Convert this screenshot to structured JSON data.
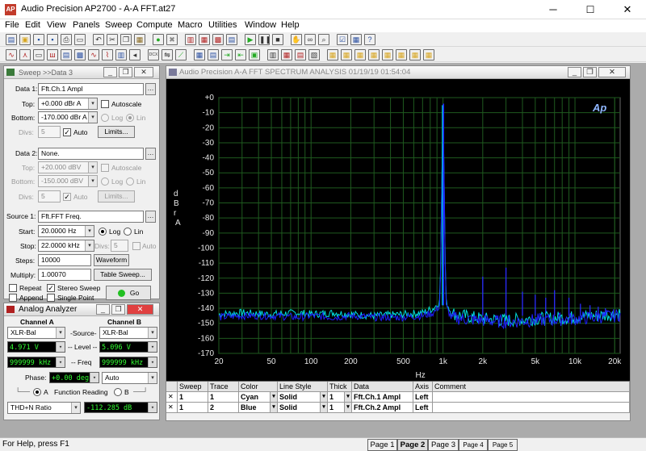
{
  "window": {
    "title": "Audio Precision AP2700 - A-A FFT.at27",
    "icon": "AP",
    "minimize": "─",
    "maximize": "☐",
    "close": "✕"
  },
  "menu": [
    "File",
    "Edit",
    "View",
    "Panels",
    "Sweep",
    "Compute",
    "Macro",
    "Utilities",
    "Window",
    "Help"
  ],
  "toolbar": {
    "row1": [
      {
        "icon": "new-doc-icon",
        "glyph": "▤",
        "color": "#2a4fa0"
      },
      {
        "icon": "open-folder-icon",
        "glyph": "▣",
        "color": "#d7a520"
      },
      {
        "icon": "save-icon",
        "glyph": "▪",
        "color": "#1f4f9f"
      },
      {
        "icon": "save-as-icon",
        "glyph": "▪",
        "color": "#1f4f9f"
      },
      {
        "icon": "print-icon",
        "glyph": "⎙",
        "color": "#333333"
      },
      {
        "icon": "preview-icon",
        "glyph": "▭",
        "color": "#333333"
      },
      {
        "icon": "undo-icon",
        "glyph": "↶",
        "color": "#333333"
      },
      {
        "icon": "cut-icon",
        "glyph": "✂",
        "color": "#333333"
      },
      {
        "icon": "copy-icon",
        "glyph": "❐",
        "color": "#333333"
      },
      {
        "icon": "paste-icon",
        "glyph": "▦",
        "color": "#8a6a20"
      },
      {
        "icon": "record-icon",
        "glyph": "●",
        "color": "#22aa22"
      },
      {
        "icon": "stop-record-icon",
        "glyph": "✖",
        "color": "#888888"
      },
      {
        "icon": "sweep-settings-icon",
        "glyph": "▥",
        "color": "#b02020"
      },
      {
        "icon": "analyzer-icon",
        "glyph": "▦",
        "color": "#b02020"
      },
      {
        "icon": "generator-icon",
        "glyph": "▩",
        "color": "#b02020"
      },
      {
        "icon": "graph-icon",
        "glyph": "▤",
        "color": "#2a4fa0"
      },
      {
        "icon": "play-icon",
        "glyph": "▶",
        "color": "#22aa22"
      },
      {
        "icon": "pause-icon",
        "glyph": "❚❚",
        "color": "#333333"
      },
      {
        "icon": "stop-icon",
        "glyph": "■",
        "color": "#333333"
      },
      {
        "icon": "hand-icon",
        "glyph": "✋",
        "color": "#333333"
      },
      {
        "icon": "binoculars-icon",
        "glyph": "∞",
        "color": "#333333"
      },
      {
        "icon": "zoom-icon",
        "glyph": "⌕",
        "color": "#333333"
      },
      {
        "icon": "check-list-icon",
        "glyph": "☑",
        "color": "#2a4fa0"
      },
      {
        "icon": "chart-check-icon",
        "glyph": "▦",
        "color": "#2a4fa0"
      },
      {
        "icon": "help-pointer-icon",
        "glyph": "?",
        "color": "#2a4fa0"
      }
    ],
    "row2": [
      {
        "icon": "sine-wave-icon",
        "glyph": "∿",
        "color": "#b02020"
      },
      {
        "icon": "filter-icon",
        "glyph": "⋏",
        "color": "#b02020"
      },
      {
        "icon": "channel-icon",
        "glyph": "▭",
        "color": "#333333"
      },
      {
        "icon": "multitone-icon",
        "glyph": "ш",
        "color": "#b02020"
      },
      {
        "icon": "meter-icon",
        "glyph": "▤",
        "color": "#2a4fa0"
      },
      {
        "icon": "dsp-icon",
        "glyph": "▩",
        "color": "#2a4fa0"
      },
      {
        "icon": "wave-chart-icon",
        "glyph": "∿",
        "color": "#b02020"
      },
      {
        "icon": "waveform-icon",
        "glyph": "⌇",
        "color": "#b02020"
      },
      {
        "icon": "spectrum-icon",
        "glyph": "▥",
        "color": "#2a4fa0"
      },
      {
        "icon": "speaker-icon",
        "glyph": "◂",
        "color": "#333333"
      },
      {
        "icon": "dcx-icon",
        "glyph": "DCX",
        "color": "#333333"
      },
      {
        "icon": "switcher-icon",
        "glyph": "⇋",
        "color": "#333333"
      },
      {
        "icon": "sweep-graph-icon",
        "glyph": "⟋",
        "color": "#22aa22"
      },
      {
        "icon": "table-icon",
        "glyph": "▦",
        "color": "#2a4fa0"
      },
      {
        "icon": "limits-icon",
        "glyph": "▤",
        "color": "#2a4fa0"
      },
      {
        "icon": "export-icon",
        "glyph": "⇥",
        "color": "#22aa22"
      },
      {
        "icon": "import-icon",
        "glyph": "⇤",
        "color": "#22aa22"
      },
      {
        "icon": "compute-icon",
        "glyph": "▣",
        "color": "#22aa22"
      },
      {
        "icon": "graph-options-icon",
        "glyph": "▥",
        "color": "#333333"
      },
      {
        "icon": "fft-icon",
        "glyph": "▦",
        "color": "#b02020"
      },
      {
        "icon": "plot-icon",
        "glyph": "▤",
        "color": "#b02020"
      },
      {
        "icon": "log-icon",
        "glyph": "▧",
        "color": "#333333"
      },
      {
        "icon": "chart-a-icon",
        "glyph": "▦",
        "color": "#d7a520"
      },
      {
        "icon": "chart-b-icon",
        "glyph": "▦",
        "color": "#d7a520"
      },
      {
        "icon": "chart-c-icon",
        "glyph": "▦",
        "color": "#d7a520"
      },
      {
        "icon": "chart-d-icon",
        "glyph": "▦",
        "color": "#d7a520"
      },
      {
        "icon": "chart-e-icon",
        "glyph": "▦",
        "color": "#d7a520"
      },
      {
        "icon": "chart-f-icon",
        "glyph": "▦",
        "color": "#d7a520"
      },
      {
        "icon": "chart-g-icon",
        "glyph": "▦",
        "color": "#d7a520"
      },
      {
        "icon": "chart-h-icon",
        "glyph": "▦",
        "color": "#d7a520"
      }
    ]
  },
  "sweep": {
    "title": "Sweep  >>Data 3",
    "data1_label": "Data 1:",
    "data1_value": "Fft.Ch.1 Ampl",
    "top_label": "Top:",
    "top_value": "+0.000  dBr A",
    "bottom_label": "Bottom:",
    "bottom_value": "-170.000 dBr A",
    "autoscale": "Autoscale",
    "log": "Log",
    "lin": "Lin",
    "divs_label": "Divs:",
    "divs_value": "5",
    "auto": "Auto",
    "limits": "Limits...",
    "data2_label": "Data 2:",
    "data2_value": "None.",
    "top2_value": "+20.000  dBV",
    "bottom2_value": "-150.000 dBV",
    "divs2_value": "5",
    "source_label": "Source 1:",
    "source_value": "Fft.FFT Freq.",
    "start_label": "Start:",
    "start_value": "20.0000  Hz",
    "stop_label": "Stop:",
    "stop_value": "22.0000 kHz",
    "divs3_value": "5",
    "steps_label": "Steps:",
    "steps_value": "10000",
    "waveform": "Waveform",
    "multiply_label": "Multiply:",
    "multiply_value": "1.00070",
    "table_sweep": "Table Sweep...",
    "repeat": "Repeat",
    "stereo_sweep": "Stereo Sweep",
    "append": "Append",
    "single_point": "Single Point",
    "go": "Go"
  },
  "analyzer": {
    "title": "Analog Analyzer",
    "channel_a": "Channel A",
    "channel_b": "Channel B",
    "source_label": "-Source-",
    "input_a": "XLR-Bal",
    "input_b": "XLR-Bal",
    "level_label": "-- Level --",
    "level_a": "4.971   V",
    "level_b": "5.096   V",
    "freq_label": "-- Freq",
    "freq_a": "999999 kHz",
    "freq_b": "999999 kHz",
    "phase_label": "Phase:",
    "phase_value": "+0.00   deg",
    "phase_mode": "Auto",
    "reading_a": "A",
    "function_reading": "Function Reading",
    "reading_b": "B",
    "function_mode": "THD+N Ratio",
    "function_value": "-112.285 dB"
  },
  "graph": {
    "titlebar": "Audio Precision     A-A FFT SPECTRUM ANALYSIS     01/19/19 01:54:04",
    "logo": "Ap",
    "grid_color": "#1f5a1f"
  },
  "chart_data": {
    "type": "line",
    "title": "A-A FFT SPECTRUM ANALYSIS",
    "ylabel": "d B r  A",
    "xlabel": "Hz",
    "x_scale": "log",
    "xlim": [
      20,
      22000
    ],
    "ylim": [
      -170,
      0
    ],
    "grid": true,
    "y_ticks": [
      "+0",
      "-10",
      "-20",
      "-30",
      "-40",
      "-50",
      "-60",
      "-70",
      "-80",
      "-90",
      "-100",
      "-110",
      "-120",
      "-130",
      "-140",
      "-150",
      "-160",
      "-170"
    ],
    "x_ticks": [
      "20",
      "50",
      "100",
      "200",
      "500",
      "1k",
      "2k",
      "5k",
      "10k",
      "20k"
    ],
    "series": [
      {
        "name": "Fft.Ch.1 Ampl",
        "color": "#00e0e0",
        "x": [
          20,
          30,
          50,
          80,
          100,
          150,
          200,
          300,
          500,
          700,
          850,
          950,
          1000,
          1050,
          1150,
          1400,
          2000,
          3000,
          5000,
          10000,
          20000,
          22000
        ],
        "y": [
          -144,
          -143,
          -144,
          -143,
          -144,
          -143,
          -144,
          -145,
          -144,
          -143,
          -140,
          -135,
          -5,
          -135,
          -143,
          -145,
          -147,
          -148,
          -147,
          -146,
          -144,
          -143
        ]
      },
      {
        "name": "Fft.Ch.2 Ampl",
        "color": "#2020ff",
        "x": [
          20,
          30,
          50,
          80,
          100,
          150,
          200,
          300,
          500,
          700,
          850,
          950,
          1000,
          1050,
          1150,
          1400,
          2000,
          3000,
          5000,
          10000,
          20000,
          22000
        ],
        "y": [
          -146,
          -145,
          -145,
          -146,
          -145,
          -146,
          -145,
          -146,
          -146,
          -145,
          -143,
          -138,
          -4,
          -138,
          -146,
          -147,
          -148,
          -149,
          -148,
          -147,
          -145,
          -144
        ]
      }
    ],
    "harmonics": [
      {
        "x": 2000,
        "y": -119
      },
      {
        "x": 3000,
        "y": -113
      },
      {
        "x": 4000,
        "y": -129
      },
      {
        "x": 5000,
        "y": -131
      },
      {
        "x": 6000,
        "y": -133
      },
      {
        "x": 7000,
        "y": -128
      },
      {
        "x": 9000,
        "y": -133
      },
      {
        "x": 11000,
        "y": -137
      },
      {
        "x": 13000,
        "y": -138
      },
      {
        "x": 15000,
        "y": -139
      },
      {
        "x": 17000,
        "y": -140
      }
    ]
  },
  "trace_table": {
    "headers": [
      "Sweep",
      "Trace",
      "Color",
      "Line Style",
      "Thick",
      "Data",
      "Axis",
      "Comment"
    ],
    "rows": [
      {
        "sweep": "1",
        "trace": "1",
        "color": "Cyan",
        "style": "Solid",
        "thick": "1",
        "data": "Fft.Ch.1 Ampl",
        "axis": "Left",
        "comment": ""
      },
      {
        "sweep": "1",
        "trace": "2",
        "color": "Blue",
        "style": "Solid",
        "thick": "1",
        "data": "Fft.Ch.2 Ampl",
        "axis": "Left",
        "comment": ""
      }
    ]
  },
  "status": {
    "help": "For Help, press F1",
    "pages": [
      "Page 1",
      "Page 2",
      "Page 3",
      "Page 4",
      "Page 5"
    ],
    "active_page": "Page 2"
  }
}
